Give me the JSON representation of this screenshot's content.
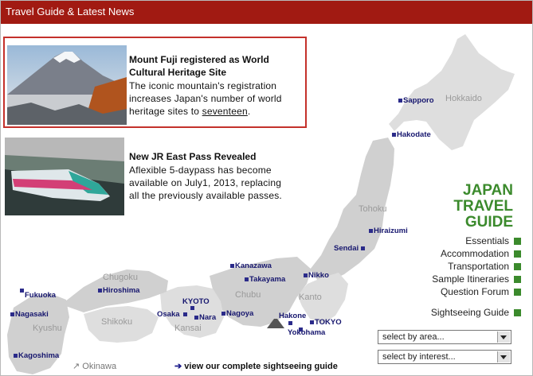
{
  "header": {
    "title": "Travel Guide & Latest News"
  },
  "news": [
    {
      "title_line1": "Mount Fuji registered as World",
      "title_line2": "Cultural Heritage Site",
      "body_line1": "The iconic mountain's registration",
      "body_line2": "increases Japan's number of world",
      "body_line3a": "heritage sites to ",
      "body_link": "seventeen",
      "body_line3b": "."
    },
    {
      "title": "New JR East Pass Revealed",
      "body_line1": "Aflexible 5-daypass has become",
      "body_line2": "available on July1, 2013, replacing",
      "body_line3": "all the previously available passes."
    }
  ],
  "brand": {
    "line1": "JAPAN",
    "line2": "TRAVEL",
    "line3": "GUIDE"
  },
  "menu": [
    "Essentials",
    "Accommodation",
    "Transportation",
    "Sample Itineraries",
    "Question Forum",
    "Sightseeing Guide"
  ],
  "selects": [
    {
      "value": "select by area..."
    },
    {
      "value": "select by interest..."
    }
  ],
  "regions": {
    "hokkaido": "Hokkaido",
    "tohoku": "Tohoku",
    "chugoku": "Chugoku",
    "chubu": "Chubu",
    "kanto": "Kanto",
    "shikoku": "Shikoku",
    "kyushu": "Kyushu",
    "kansai": "Kansai"
  },
  "cities": {
    "sapporo": "Sapporo",
    "hakodate": "Hakodate",
    "hiraizumi": "Hiraizumi",
    "sendai": "Sendai",
    "kanazawa": "Kanazawa",
    "takayama": "Takayama",
    "nikko": "Nikko",
    "hiroshima": "Hiroshima",
    "fukuoka": "Fukuoka",
    "nagasaki": "Nagasaki",
    "kagoshima": "Kagoshima",
    "kyoto": "KYOTO",
    "osaka": "Osaka",
    "nara": "Nara",
    "nagoya": "Nagoya",
    "hakone": "Hakone",
    "tokyo": "TOKYO",
    "yokohama": "Yokohama"
  },
  "okinawa": "Okinawa",
  "guide_link": "view our complete sightseeing guide",
  "colors": {
    "header": "#a11a12",
    "accent_green": "#3b8a2c",
    "highlight_border": "#c4312b",
    "city": "#16166e"
  }
}
